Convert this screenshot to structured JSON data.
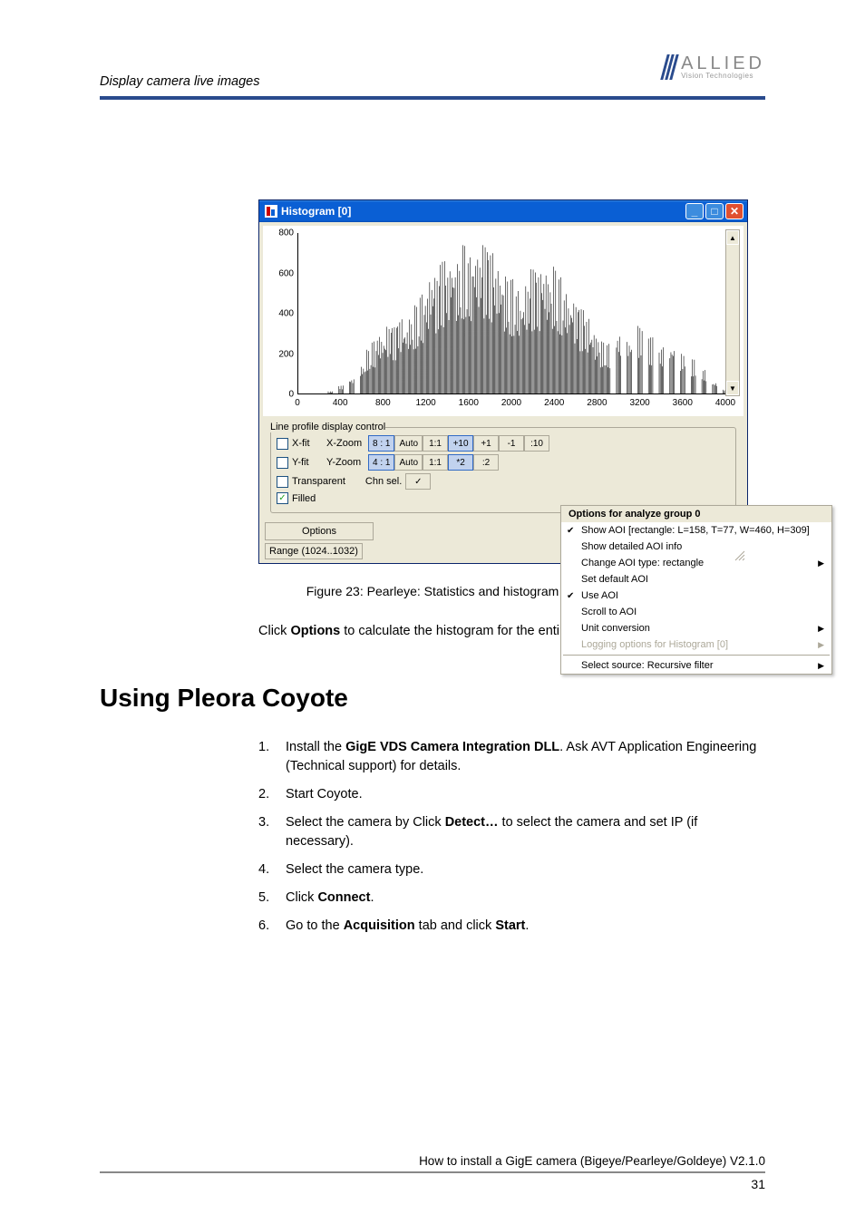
{
  "header": {
    "title": "Display camera live images",
    "logo_main": "ALLIED",
    "logo_sub": "Vision Technologies"
  },
  "window": {
    "title": "Histogram [0]",
    "options_btn": "Options",
    "close_btn": "Close",
    "range_label": "Range (1024..1032)"
  },
  "chart_data": {
    "type": "line",
    "title": "",
    "xlabel": "",
    "ylabel": "",
    "xlim": [
      0,
      4000
    ],
    "ylim": [
      0,
      800
    ],
    "x_ticks": [
      0,
      400,
      800,
      1200,
      1600,
      2000,
      2400,
      2800,
      3200,
      3600,
      4000
    ],
    "y_ticks": [
      0,
      200,
      400,
      600,
      800
    ],
    "series": [
      {
        "name": "histogram",
        "x": [
          0,
          200,
          300,
          400,
          500,
          600,
          650,
          700,
          750,
          800,
          850,
          900,
          950,
          1000,
          1050,
          1100,
          1150,
          1200,
          1250,
          1300,
          1350,
          1400,
          1450,
          1500,
          1550,
          1600,
          1650,
          1700,
          1750,
          1800,
          1850,
          1900,
          1950,
          2000,
          2050,
          2100,
          2150,
          2200,
          2250,
          2300,
          2350,
          2400,
          2450,
          2500,
          2550,
          2600,
          2650,
          2700,
          2750,
          2800,
          2850,
          2900,
          3000,
          3100,
          3200,
          3300,
          3400,
          3500,
          3600,
          3700,
          3800,
          3900,
          4000
        ],
        "values": [
          0,
          0,
          10,
          40,
          80,
          150,
          220,
          260,
          310,
          300,
          340,
          330,
          380,
          360,
          400,
          440,
          500,
          540,
          620,
          580,
          660,
          640,
          720,
          680,
          740,
          700,
          760,
          720,
          740,
          700,
          660,
          640,
          600,
          570,
          540,
          510,
          560,
          620,
          600,
          660,
          620,
          640,
          580,
          540,
          500,
          460,
          420,
          380,
          340,
          300,
          260,
          250,
          320,
          290,
          340,
          280,
          240,
          260,
          210,
          170,
          120,
          60,
          20
        ]
      }
    ]
  },
  "controls": {
    "legend": "Line profile display control",
    "xfit": "X-fit",
    "yfit": "Y-fit",
    "xzoom": "X-Zoom",
    "yzoom": "Y-Zoom",
    "transparent": "Transparent",
    "filled": "Filled",
    "chn_sel": "Chn sel.",
    "chn_val": "✓",
    "xz_btns": [
      "8 : 1",
      "Auto",
      "1:1",
      "+10",
      "+1",
      "-1",
      ":10"
    ],
    "yz_btns": [
      "4 : 1",
      "Auto",
      "1:1",
      "*2",
      ":2"
    ]
  },
  "menu": {
    "title": "Options for analyze group 0",
    "items": [
      {
        "label": "Show AOI [rectangle: L=158, T=77, W=460, H=309]",
        "checked": true
      },
      {
        "label": "Show detailed AOI info"
      },
      {
        "label": "Change AOI type: rectangle",
        "submenu": true
      },
      {
        "label": "Set default AOI"
      },
      {
        "label": "Use AOI",
        "checked": true
      },
      {
        "label": "Scroll to AOI"
      },
      {
        "label": "Unit conversion",
        "submenu": true
      },
      {
        "label": "Logging options for Histogram [0]",
        "submenu": true,
        "disabled": true
      },
      {
        "sep": true
      },
      {
        "label": "Select source: Recursive filter",
        "submenu": true
      }
    ]
  },
  "figure_caption": "Figure 23: Pearleye: Statistics and histogram",
  "paragraph": {
    "pre": "Click ",
    "bold": "Options",
    "post": " to calculate the histogram for the entire image or only for an AOI."
  },
  "section_heading": "Using Pleora Coyote",
  "steps": [
    {
      "n": "1.",
      "parts": [
        "Install the ",
        {
          "b": "GigE VDS Camera Integration DLL"
        },
        ". Ask AVT Application Engineering (Technical support) for details."
      ]
    },
    {
      "n": "2.",
      "parts": [
        "Start Coyote."
      ]
    },
    {
      "n": "3.",
      "parts": [
        "Select the camera by Click ",
        {
          "b": "Detect…"
        },
        " to select the camera and set IP (if necessary)."
      ]
    },
    {
      "n": "4.",
      "parts": [
        "Select the camera type."
      ]
    },
    {
      "n": "5.",
      "parts": [
        "Click ",
        {
          "b": "Connect"
        },
        "."
      ]
    },
    {
      "n": "6.",
      "parts": [
        "Go to the ",
        {
          "b": "Acquisition"
        },
        " tab and click ",
        {
          "b": "Start"
        },
        "."
      ]
    }
  ],
  "footer": {
    "text": "How to install a GigE camera (Bigeye/Pearleye/Goldeye) V2.1.0",
    "page": "31"
  }
}
